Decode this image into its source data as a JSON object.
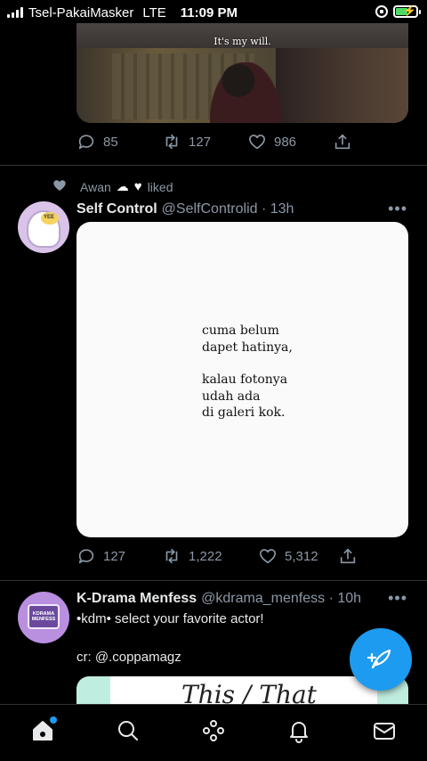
{
  "status_bar": {
    "carrier": "Tsel-PakaiMasker",
    "network": "LTE",
    "time": "11:09 PM"
  },
  "top_tweet": {
    "media_subtitle": "It's my will.",
    "replies": "85",
    "retweets": "127",
    "likes": "986"
  },
  "liked_row": {
    "user": "Awan",
    "label": "liked"
  },
  "tweet_self_control": {
    "name": "Self Control",
    "handle": "@SelfControlid · 13h",
    "image_text_lines_1": [
      "cuma belum",
      "dapet hatinya,"
    ],
    "image_text_lines_2": [
      "kalau fotonya",
      "udah ada",
      "di galeri kok."
    ],
    "replies": "127",
    "retweets": "1,222",
    "likes": "5,312",
    "avatar_label": "YEE"
  },
  "tweet_kdrama": {
    "name": "K-Drama Menfess",
    "handle": "@kdrama_menfess · 10h",
    "text_line_1": "•kdm• select your favorite actor!",
    "text_line_2": "cr: @.coppamagz",
    "avatar_label": "KDRAMA MENFESS",
    "media_script": "This / That"
  },
  "more_label": "•••",
  "colors": {
    "accent": "#1d9bf0",
    "background": "#000000",
    "muted": "#8b98a5"
  },
  "icons": {
    "nav": [
      "home-icon",
      "search-icon",
      "spaces-icon",
      "notifications-icon",
      "messages-icon"
    ],
    "fab": "compose-tweet-icon"
  }
}
